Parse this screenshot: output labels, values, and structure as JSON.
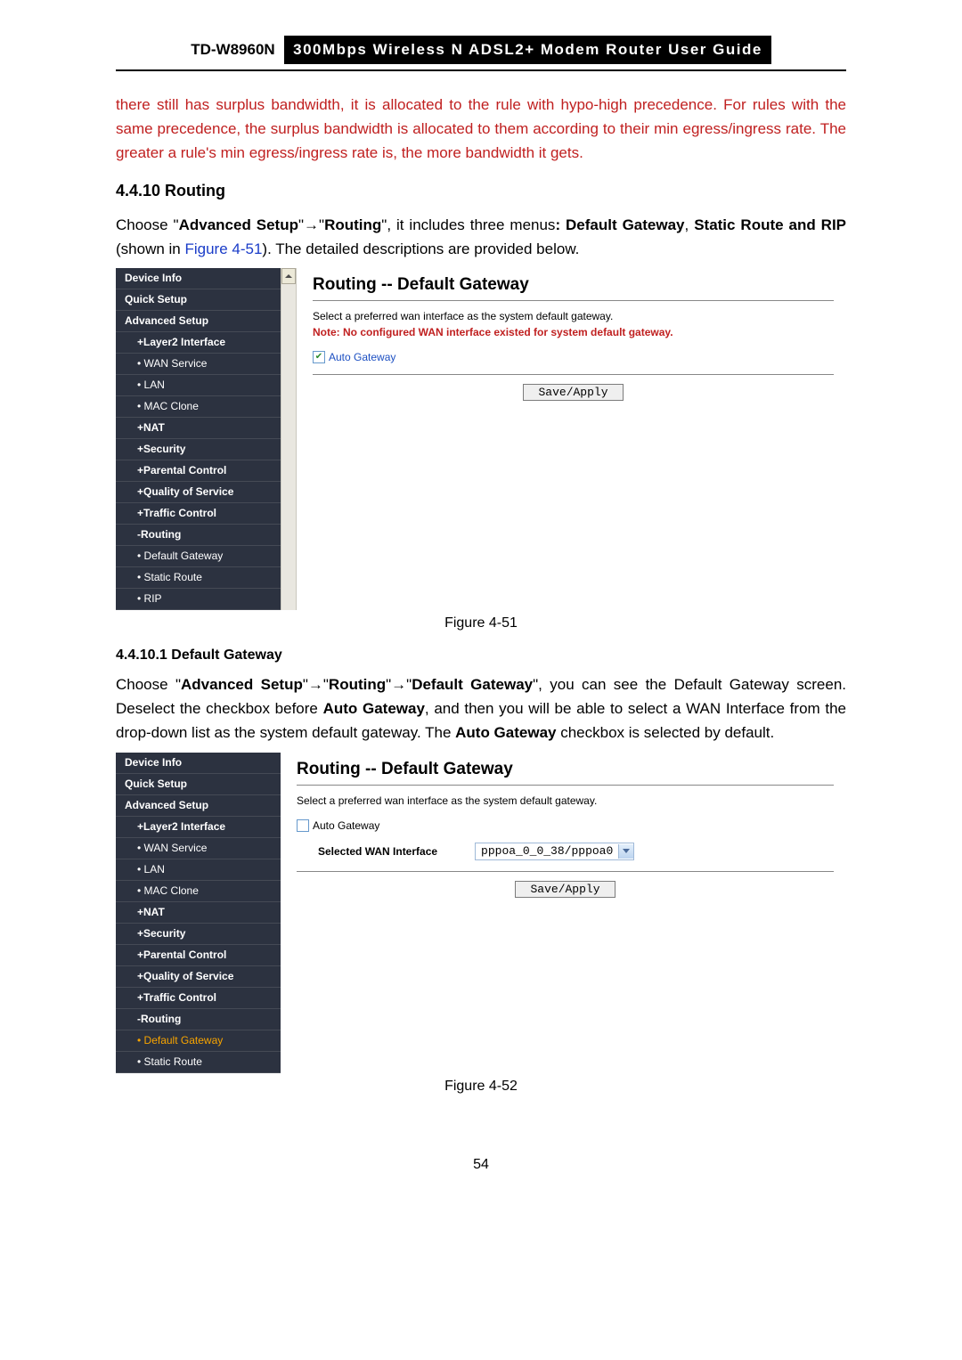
{
  "header": {
    "model": "TD-W8960N",
    "guide": "300Mbps  Wireless  N  ADSL2+  Modem  Router  User  Guide"
  },
  "para1_red": "there still has surplus bandwidth, it is allocated to the rule with hypo-high precedence. For rules with the same precedence, the surplus bandwidth is allocated to them according to their min egress/ingress rate. The greater a rule's min egress/ingress rate is, the more bandwidth it gets.",
  "section_heading": "4.4.10  Routing",
  "para2": {
    "p1": "Choose \"",
    "b1": "Advanced Setup",
    "p2": "\"→\"",
    "b2": "Routing",
    "p3": "\", it includes three menus",
    "b3": ": Default Gateway",
    "p4": ", ",
    "b4": "Static Route and RIP",
    "p5": " (shown in ",
    "link": "Figure 4-51",
    "p6": "). The detailed descriptions are provided below."
  },
  "figure1": {
    "sidebar": [
      "Device Info",
      "Quick Setup",
      "Advanced Setup",
      "+Layer2 Interface",
      "• WAN Service",
      "• LAN",
      "• MAC Clone",
      "+NAT",
      "+Security",
      "+Parental Control",
      "+Quality of Service",
      "+Traffic Control",
      "-Routing",
      "• Default Gateway",
      "• Static Route",
      "• RIP"
    ],
    "sidebar_classes": [
      "bold",
      "bold",
      "bold",
      "sub",
      "sub2",
      "sub2",
      "sub2",
      "sub",
      "sub",
      "sub",
      "sub",
      "sub",
      "sub",
      "sub2",
      "sub2",
      "sub2"
    ],
    "title": "Routing -- Default Gateway",
    "line1": "Select a preferred wan interface as the system default gateway.",
    "note": "Note: No configured WAN interface existed for system default gateway.",
    "cb_label": "Auto Gateway",
    "btn": "Save/Apply"
  },
  "caption1": "Figure 4-51",
  "sub_heading": "4.4.10.1  Default Gateway",
  "para3": {
    "p1": "Choose \"",
    "b1": "Advanced Setup",
    "p2": "\"→\"",
    "b2": "Routing",
    "p3": "\"→\"",
    "b3": "Default Gateway",
    "p4": "\", you can see the Default Gateway screen. Deselect the checkbox before ",
    "b4": "Auto Gateway",
    "p5": ", and then you will be able to select a WAN Interface from the drop-down list as the system default gateway. The ",
    "b5": "Auto Gateway",
    "p6": " checkbox is selected by default."
  },
  "figure2": {
    "sidebar": [
      "Device Info",
      "Quick Setup",
      "Advanced Setup",
      "+Layer2 Interface",
      "• WAN Service",
      "• LAN",
      "• MAC Clone",
      "+NAT",
      "+Security",
      "+Parental Control",
      "+Quality of Service",
      "+Traffic Control",
      "-Routing",
      "• Default Gateway",
      "• Static Route"
    ],
    "sidebar_classes": [
      "bold",
      "bold",
      "bold",
      "sub",
      "sub2",
      "sub2",
      "sub2",
      "sub",
      "sub",
      "sub",
      "sub",
      "sub",
      "sub",
      "sub2 active",
      "sub2"
    ],
    "title": "Routing -- Default Gateway",
    "line1": "Select a preferred wan interface as the system default gateway.",
    "cb_label": "Auto Gateway",
    "field_label": "Selected WAN Interface",
    "select_value": "pppoa_0_0_38/pppoa0",
    "btn": "Save/Apply"
  },
  "caption2": "Figure 4-52",
  "page_number": "54"
}
